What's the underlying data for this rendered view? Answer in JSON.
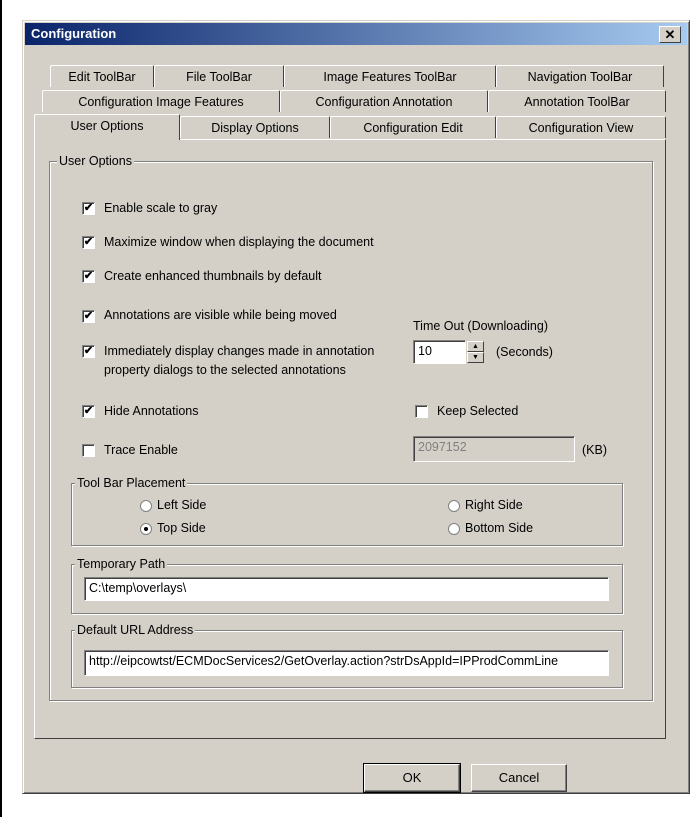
{
  "window": {
    "title": "Configuration",
    "close_glyph": "✕"
  },
  "tabs": {
    "row1": [
      "Edit ToolBar",
      "File ToolBar",
      "Image Features ToolBar",
      "Navigation ToolBar"
    ],
    "row2": [
      "Configuration Image Features",
      "Configuration Annotation",
      "Annotation ToolBar"
    ],
    "row3": [
      "User Options",
      "Display Options",
      "Configuration Edit",
      "Configuration View"
    ],
    "active": "User Options"
  },
  "user_options": {
    "group_label": "User Options",
    "checkboxes": [
      {
        "label": "Enable scale to gray",
        "checked": true
      },
      {
        "label": "Maximize window when displaying the document",
        "checked": true
      },
      {
        "label": "Create enhanced thumbnails by default",
        "checked": true
      },
      {
        "label": "Annotations are visible while being moved",
        "checked": true
      },
      {
        "label": "Immediately display changes made in annotation",
        "label2": "property dialogs to the selected annotations",
        "checked": true
      },
      {
        "label": "Hide Annotations",
        "checked": true
      },
      {
        "label": "Trace Enable",
        "checked": false
      }
    ],
    "timeout": {
      "label": "Time Out  (Downloading)",
      "value": "10",
      "unit": "(Seconds)"
    },
    "keep_selected": {
      "label": "Keep Selected",
      "checked": false
    },
    "trace_size": {
      "value": "2097152",
      "unit": "(KB)"
    }
  },
  "toolbar_placement": {
    "label": "Tool Bar Placement",
    "options": [
      {
        "label": "Left Side",
        "selected": false
      },
      {
        "label": "Right Side",
        "selected": false
      },
      {
        "label": "Top Side",
        "selected": true
      },
      {
        "label": "Bottom Side",
        "selected": false
      }
    ]
  },
  "temporary_path": {
    "label": "Temporary Path",
    "value": "C:\\temp\\overlays\\"
  },
  "default_url": {
    "label": "Default URL Address",
    "value": "http://eipcowtst/ECMDocServices2/GetOverlay.action?strDsAppId=IPProdCommLine"
  },
  "buttons": {
    "ok": "OK",
    "cancel": "Cancel"
  },
  "check_glyph": "✔",
  "spin_up": "▲",
  "spin_down": "▼"
}
